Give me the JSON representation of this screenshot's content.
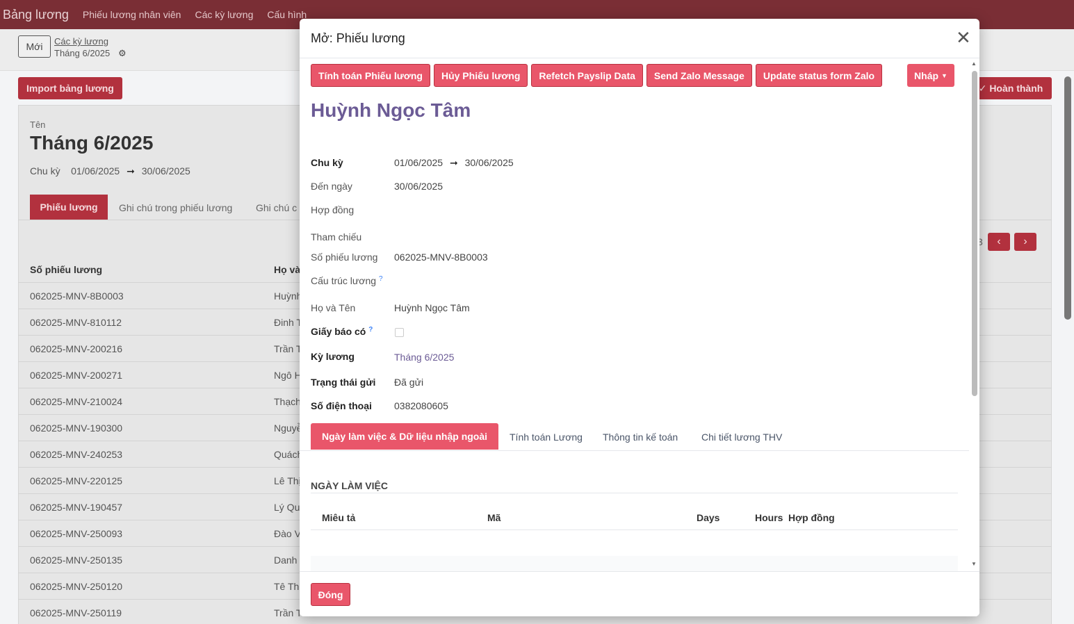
{
  "topnav": {
    "brand": "Bảng lương",
    "items": [
      "Phiếu lương nhân viên",
      "Các kỳ lương",
      "Cấu hình"
    ]
  },
  "background": {
    "new_button": "Mới",
    "breadcrumb_parent": "Các kỳ lương",
    "breadcrumb_current": "Tháng 6/2025",
    "import_button": "Import bảng lương",
    "complete_button": "Hoàn thành",
    "name_label": "Tên",
    "title": "Tháng 6/2025",
    "period_label": "Chu kỳ",
    "period_from": "01/06/2025",
    "period_to": "30/06/2025",
    "tabs": [
      "Phiếu lương",
      "Ghi chú trong phiếu lương",
      "Ghi chú c"
    ],
    "pager_text": "3",
    "columns": [
      "Số phiếu lương",
      "Họ và"
    ],
    "rows": [
      {
        "code": "062025-MNV-8B0003",
        "name": "Huỳnh"
      },
      {
        "code": "062025-MNV-810112",
        "name": "Đinh T"
      },
      {
        "code": "062025-MNV-200216",
        "name": "Trần T"
      },
      {
        "code": "062025-MNV-200271",
        "name": "Ngô H"
      },
      {
        "code": "062025-MNV-210024",
        "name": "Thạch"
      },
      {
        "code": "062025-MNV-190300",
        "name": "Nguyễ"
      },
      {
        "code": "062025-MNV-240253",
        "name": "Quách"
      },
      {
        "code": "062025-MNV-220125",
        "name": "Lê Thị"
      },
      {
        "code": "062025-MNV-190457",
        "name": "Lý Quy"
      },
      {
        "code": "062025-MNV-250093",
        "name": "Đào V"
      },
      {
        "code": "062025-MNV-250135",
        "name": "Danh"
      },
      {
        "code": "062025-MNV-250120",
        "name": "Tê Thị"
      },
      {
        "code": "062025-MNV-250119",
        "name": "Trần T"
      }
    ]
  },
  "modal": {
    "title": "Mở: Phiếu lương",
    "close_icon": "close-icon",
    "actions": [
      "Tính toán Phiếu lương",
      "Hủy Phiếu lương",
      "Refetch Payslip Data",
      "Send Zalo Message",
      "Update status form Zalo"
    ],
    "status_button": "Nháp",
    "employee_name": "Huỳnh Ngọc Tâm",
    "fields": {
      "period_label": "Chu kỳ",
      "period_from": "01/06/2025",
      "period_to": "30/06/2025",
      "to_date_label": "Đến ngày",
      "to_date_value": "30/06/2025",
      "contract_label": "Hợp đồng",
      "reference_label": "Tham chiếu",
      "payslip_no_label": "Số phiếu lương",
      "payslip_no_value": "062025-MNV-8B0003",
      "structure_label": "Cấu trúc lương",
      "fullname_label": "Họ và Tên",
      "fullname_value": "Huỳnh Ngọc Tâm",
      "credit_note_label": "Giấy báo có",
      "pay_period_label": "Kỳ lương",
      "pay_period_value": "Tháng 6/2025",
      "send_status_label": "Trạng thái gửi",
      "send_status_value": "Đã gửi",
      "phone_label": "Số điện thoại",
      "phone_value": "0382080605"
    },
    "tabs": [
      "Ngày làm việc & Dữ liệu nhập ngoài",
      "Tính toán Lương",
      "Thông tin kế toán",
      "Chi tiết lương THV"
    ],
    "section_title": "NGÀY LÀM VIỆC",
    "table_columns": [
      "Miêu tả",
      "Mã",
      "Days",
      "Hours",
      "Hợp đồng"
    ],
    "close_button": "Đóng"
  }
}
